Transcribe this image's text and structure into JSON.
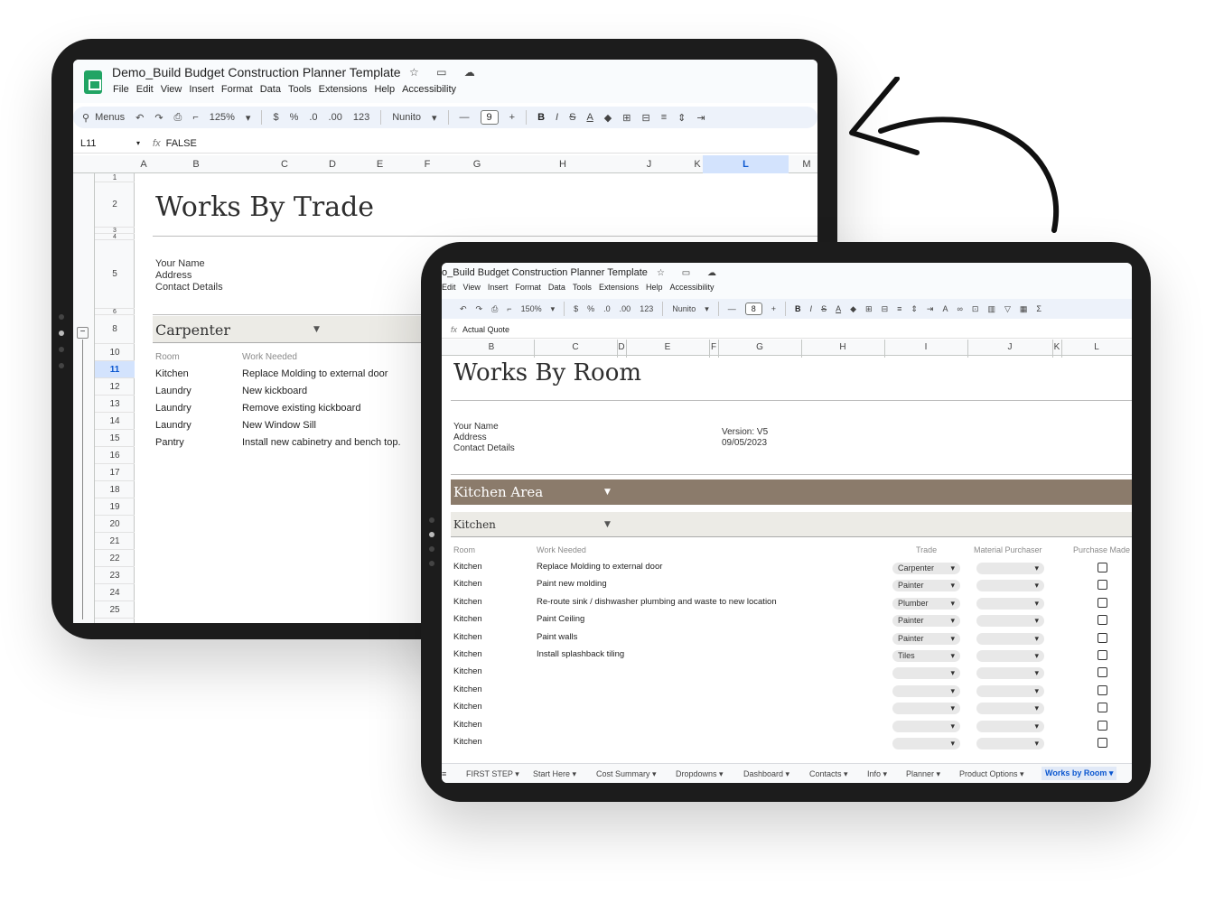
{
  "back_tablet": {
    "doc_title": "Demo_Build Budget Construction Planner Template",
    "doc_icons": "☆ ▭ ☁",
    "menu": [
      "File",
      "Edit",
      "View",
      "Insert",
      "Format",
      "Data",
      "Tools",
      "Extensions",
      "Help",
      "Accessibility"
    ],
    "toolbar": {
      "menus": "Menus",
      "zoom": "125%",
      "currency": "$",
      "percent": "%",
      "dec_minus": ".0",
      "dec_plus": ".00",
      "num": "123",
      "font": "Nunito",
      "font_size": "9"
    },
    "cell_ref": "L11",
    "formula": "FALSE",
    "columns": [
      "A",
      "B",
      "C",
      "D",
      "E",
      "F",
      "G",
      "H",
      "J",
      "K",
      "L",
      "M"
    ],
    "rows": [
      "1",
      "2",
      "3",
      "4",
      "5",
      "6",
      "8",
      "10",
      "11",
      "12",
      "13",
      "14",
      "15",
      "16",
      "17",
      "18",
      "19",
      "20",
      "21",
      "22",
      "23",
      "24",
      "25"
    ],
    "page_title": "Works By Trade",
    "contact": {
      "name": "Your Name",
      "address": "Address",
      "details": "Contact Details"
    },
    "section": "Carpenter",
    "col_room": "Room",
    "col_work": "Work Needed",
    "items": [
      {
        "room": "Kitchen",
        "work": "Replace Molding to external door"
      },
      {
        "room": "Laundry",
        "work": "New kickboard"
      },
      {
        "room": "Laundry",
        "work": "Remove existing kickboard"
      },
      {
        "room": "Laundry",
        "work": "New Window Sill"
      },
      {
        "room": "Pantry",
        "work": "Install new cabinetry and bench top."
      }
    ]
  },
  "front_tablet": {
    "doc_title": "o_Build Budget Construction Planner Template",
    "menu": [
      "Edit",
      "View",
      "Insert",
      "Format",
      "Data",
      "Tools",
      "Extensions",
      "Help",
      "Accessibility"
    ],
    "toolbar": {
      "zoom": "150%",
      "currency": "$",
      "percent": "%",
      "dec_minus": ".0",
      "dec_plus": ".00",
      "num": "123",
      "font": "Nunito",
      "font_size": "8"
    },
    "formula": "Actual Quote",
    "columns": [
      "B",
      "C",
      "D",
      "E",
      "F",
      "G",
      "H",
      "I",
      "J",
      "K",
      "L"
    ],
    "page_title": "Works By Room",
    "contact": {
      "name": "Your Name",
      "address": "Address",
      "details": "Contact Details"
    },
    "version": "Version: V5",
    "date": "09/05/2023",
    "area": "Kitchen Area",
    "subsection": "Kitchen",
    "col_room": "Room",
    "col_work": "Work Needed",
    "col_trade": "Trade",
    "col_purchaser": "Material Purchaser",
    "col_purchase": "Purchase Made",
    "items": [
      {
        "room": "Kitchen",
        "work": "Replace Molding to external door",
        "trade": "Carpenter"
      },
      {
        "room": "Kitchen",
        "work": "Paint new molding",
        "trade": "Painter"
      },
      {
        "room": "Kitchen",
        "work": "Re-route sink / dishwasher plumbing and waste to new location",
        "trade": "Plumber"
      },
      {
        "room": "Kitchen",
        "work": "Paint Ceiling",
        "trade": "Painter"
      },
      {
        "room": "Kitchen",
        "work": "Paint walls",
        "trade": "Painter"
      },
      {
        "room": "Kitchen",
        "work": "Install splashback tiling",
        "trade": "Tiles"
      },
      {
        "room": "Kitchen",
        "work": "",
        "trade": ""
      },
      {
        "room": "Kitchen",
        "work": "",
        "trade": ""
      },
      {
        "room": "Kitchen",
        "work": "",
        "trade": ""
      },
      {
        "room": "Kitchen",
        "work": "",
        "trade": ""
      },
      {
        "room": "Kitchen",
        "work": "",
        "trade": ""
      }
    ],
    "tabs": [
      "FIRST STEP",
      "Start Here",
      "Cost Summary",
      "Dropdowns",
      "Dashboard",
      "Contacts",
      "Info",
      "Planner",
      "Product Options",
      "Works by Room"
    ],
    "active_tab": "Works by Room"
  },
  "colors": {
    "band_dark": "#8b7b6b",
    "band_light": "#ecebe6",
    "sheets_green": "#21a464",
    "selection_blue": "#d3e3fd"
  }
}
